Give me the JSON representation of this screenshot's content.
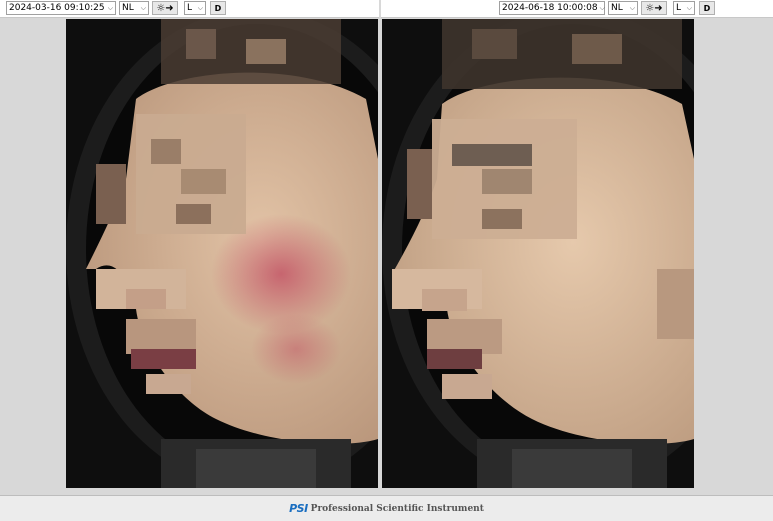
{
  "left_panel": {
    "datetime": "2024-03-16 09:10:25",
    "mode": "NL",
    "side": "L",
    "d_button": "D"
  },
  "right_panel": {
    "datetime": "2024-06-18 10:00:08",
    "mode": "NL",
    "side": "L",
    "d_button": "D"
  },
  "footer": {
    "logo": "PSI",
    "company": "Professional Scientific Instrument"
  },
  "colors": {
    "logo_blue": "#1a6ec0",
    "background": "#d8d8d8",
    "skin": "#d9b79a"
  },
  "icons": {
    "light_toggle": "sun-arrow-icon",
    "dropdown": "chevron-down-icon"
  }
}
